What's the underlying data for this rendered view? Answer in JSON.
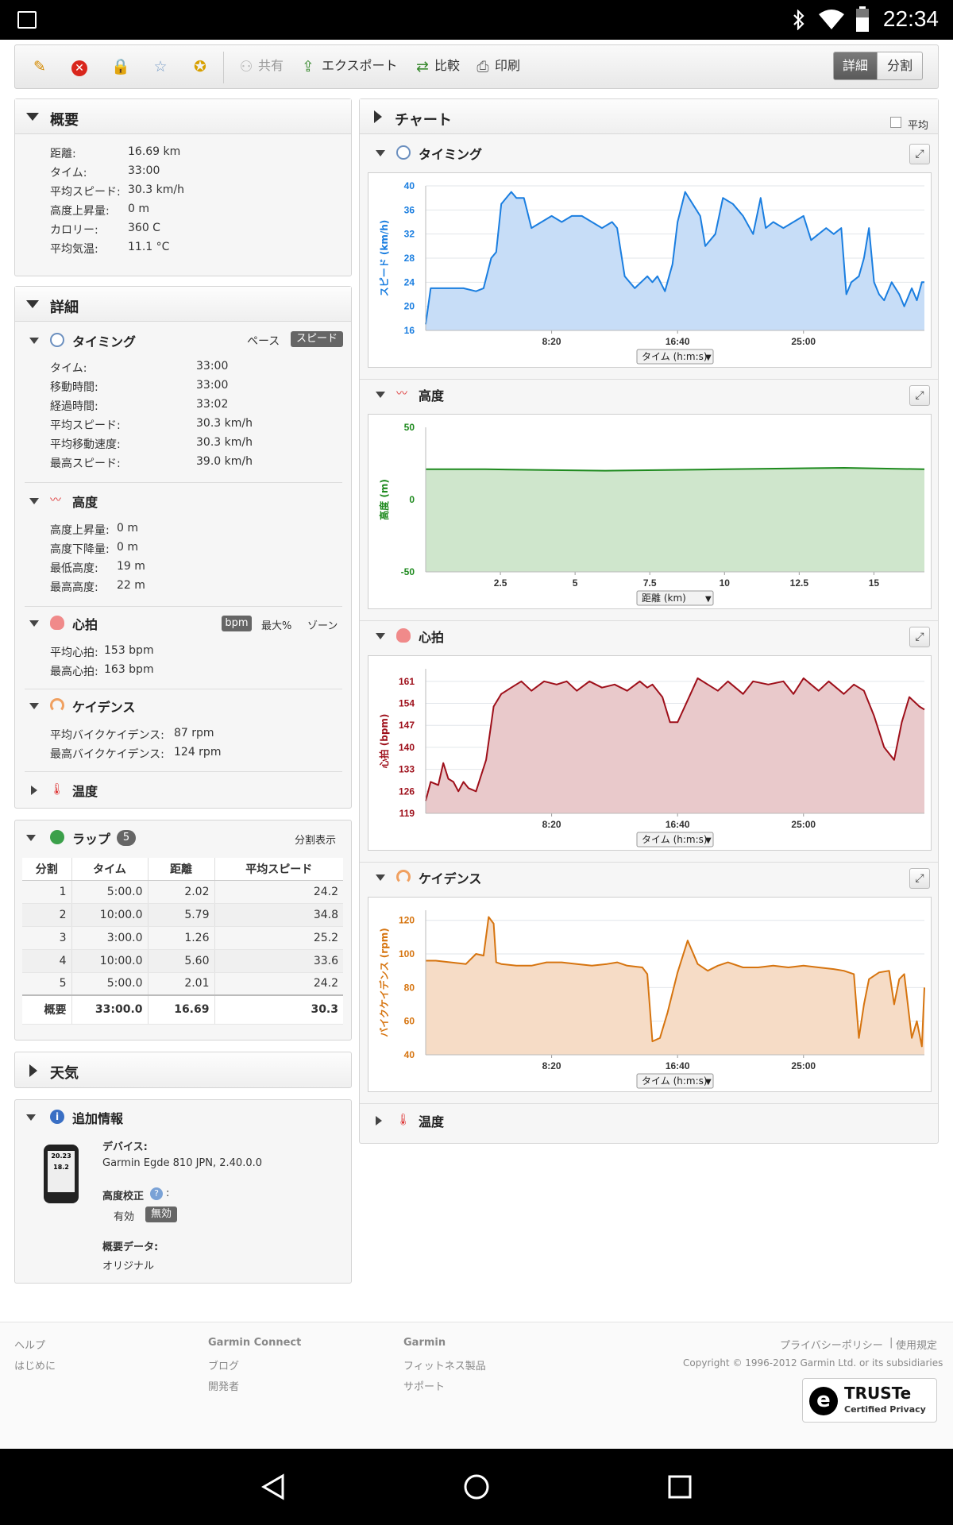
{
  "status_bar": {
    "time": "22:34"
  },
  "toolbar": {
    "share": "共有",
    "export": "エクスポート",
    "compare": "比較",
    "print": "印刷",
    "view_detail": "詳細",
    "view_split": "分割"
  },
  "summary": {
    "title": "概要",
    "rows": [
      {
        "label": "距離:",
        "value": "16.69 km"
      },
      {
        "label": "タイム:",
        "value": "33:00"
      },
      {
        "label": "平均スピード:",
        "value": "30.3 km/h"
      },
      {
        "label": "高度上昇量:",
        "value": "0 m"
      },
      {
        "label": "カロリー:",
        "value": "360 C"
      },
      {
        "label": "平均気温:",
        "value": "11.1 °C"
      }
    ]
  },
  "details": {
    "title": "詳細",
    "timing": {
      "title": "タイミング",
      "pace": "ペース",
      "speed": "スピード",
      "rows": [
        {
          "label": "タイム:",
          "value": "33:00"
        },
        {
          "label": "移動時間:",
          "value": "33:00"
        },
        {
          "label": "経過時間:",
          "value": "33:02"
        },
        {
          "label": "平均スピード:",
          "value": "30.3 km/h"
        },
        {
          "label": "平均移動速度:",
          "value": "30.3 km/h"
        },
        {
          "label": "最高スピード:",
          "value": "39.0 km/h"
        }
      ]
    },
    "elevation": {
      "title": "高度",
      "rows": [
        {
          "label": "高度上昇量:",
          "value": "0 m"
        },
        {
          "label": "高度下降量:",
          "value": "0 m"
        },
        {
          "label": "最低高度:",
          "value": "19 m"
        },
        {
          "label": "最高高度:",
          "value": "22 m"
        }
      ]
    },
    "heart": {
      "title": "心拍",
      "bpm": "bpm",
      "max_pct": "最大%",
      "zone": "ゾーン",
      "rows": [
        {
          "label": "平均心拍:",
          "value": "153 bpm"
        },
        {
          "label": "最高心拍:",
          "value": "163 bpm"
        }
      ]
    },
    "cadence": {
      "title": "ケイデンス",
      "rows": [
        {
          "label": "平均バイクケイデンス:",
          "value": "87 rpm"
        },
        {
          "label": "最高バイクケイデンス:",
          "value": "124 rpm"
        }
      ]
    },
    "temperature": {
      "title": "温度"
    }
  },
  "laps": {
    "title": "ラップ",
    "count": "5",
    "split_view": "分割表示",
    "headers": [
      "分割",
      "タイム",
      "距離",
      "平均スピード"
    ],
    "rows": [
      [
        "1",
        "5:00.0",
        "2.02",
        "24.2"
      ],
      [
        "2",
        "10:00.0",
        "5.79",
        "34.8"
      ],
      [
        "3",
        "3:00.0",
        "1.26",
        "25.2"
      ],
      [
        "4",
        "10:00.0",
        "5.60",
        "33.6"
      ],
      [
        "5",
        "5:00.0",
        "2.01",
        "24.2"
      ]
    ],
    "total": [
      "概要",
      "33:00.0",
      "16.69",
      "30.3"
    ]
  },
  "weather": {
    "title": "天気"
  },
  "additional": {
    "title": "追加情報",
    "device_label": "デバイス:",
    "device_value": "Garmin Egde 810 JPN, 2.40.0.0",
    "elev_corr_label": "高度校正",
    "elev_corr_colon": ":",
    "enabled": "有効",
    "disabled": "無効",
    "summary_label": "概要データ:",
    "summary_value": "オリジナル",
    "device_screen_1": "20.23",
    "device_screen_2": "18.2"
  },
  "charts_panel": {
    "title": "チャート",
    "average": "平均",
    "sections": {
      "timing": "タイミング",
      "elevation": "高度",
      "heart": "心拍",
      "cadence": "ケイデンス",
      "temperature": "温度"
    }
  },
  "chart_data": [
    {
      "id": "speed",
      "type": "area",
      "color": "#1a7ee0",
      "fill": "#c7ddf7",
      "ylabel": "スピード (km/h)",
      "ylim": [
        16,
        40
      ],
      "yticks": [
        16,
        20,
        24,
        28,
        32,
        36,
        40
      ],
      "xlim": [
        0,
        1980
      ],
      "xticks": [
        {
          "v": 500,
          "t": "8:20"
        },
        {
          "v": 1000,
          "t": "16:40"
        },
        {
          "v": 1500,
          "t": "25:00"
        }
      ],
      "selector": "タイム (h:m:s)",
      "grid": true,
      "x": [
        0,
        20,
        60,
        100,
        150,
        200,
        230,
        260,
        280,
        300,
        340,
        360,
        390,
        420,
        460,
        500,
        540,
        580,
        620,
        660,
        700,
        740,
        760,
        790,
        830,
        880,
        900,
        920,
        950,
        980,
        1000,
        1030,
        1060,
        1090,
        1110,
        1150,
        1180,
        1220,
        1260,
        1300,
        1330,
        1350,
        1380,
        1420,
        1460,
        1500,
        1530,
        1560,
        1590,
        1620,
        1650,
        1670,
        1690,
        1720,
        1740,
        1760,
        1780,
        1800,
        1820,
        1850,
        1880,
        1900,
        1930,
        1950,
        1970,
        1980
      ],
      "y": [
        17,
        23,
        23,
        23,
        23,
        22.5,
        23,
        28,
        29,
        37,
        39,
        38,
        38,
        33,
        34,
        35,
        34,
        35,
        35,
        34,
        33,
        34,
        33,
        25,
        23,
        25,
        24,
        25,
        22.5,
        27,
        34,
        39,
        37,
        35,
        30,
        32,
        38,
        37,
        35,
        32,
        38,
        33,
        34,
        33,
        34,
        35,
        31,
        32,
        33,
        32,
        33,
        22,
        24,
        25,
        28,
        33,
        24,
        22,
        21,
        24,
        22,
        20,
        23,
        21,
        24,
        24
      ]
    },
    {
      "id": "elevation",
      "type": "area",
      "color": "#1e8a1e",
      "fill": "#cfe6cc",
      "ylabel": "高度 (m)",
      "ylim": [
        -50,
        50
      ],
      "yticks": [
        -50,
        0,
        50
      ],
      "xlim": [
        0,
        16.69
      ],
      "xticks": [
        {
          "v": 2.5,
          "t": "2.5"
        },
        {
          "v": 5,
          "t": "5"
        },
        {
          "v": 7.5,
          "t": "7.5"
        },
        {
          "v": 10,
          "t": "10"
        },
        {
          "v": 12.5,
          "t": "12.5"
        },
        {
          "v": 15,
          "t": "15"
        }
      ],
      "selector": "距離 (km)",
      "grid": false,
      "x": [
        0,
        2,
        4,
        6,
        8,
        10,
        12,
        14,
        16.69
      ],
      "y": [
        21,
        21,
        20.5,
        20,
        20.5,
        21,
        21.5,
        22,
        21
      ]
    },
    {
      "id": "heart",
      "type": "area",
      "color": "#9e0f1a",
      "fill": "#e9c9cb",
      "ylabel": "心拍 (bpm)",
      "ylim": [
        119,
        165
      ],
      "yticks": [
        119,
        126,
        133,
        140,
        147,
        154,
        161
      ],
      "xlim": [
        0,
        1980
      ],
      "xticks": [
        {
          "v": 500,
          "t": "8:20"
        },
        {
          "v": 1000,
          "t": "16:40"
        },
        {
          "v": 1500,
          "t": "25:00"
        }
      ],
      "selector": "タイム (h:m:s)",
      "grid": true,
      "x": [
        0,
        20,
        50,
        70,
        90,
        110,
        130,
        150,
        170,
        200,
        240,
        270,
        300,
        340,
        380,
        420,
        470,
        520,
        560,
        600,
        650,
        700,
        750,
        800,
        850,
        880,
        900,
        940,
        970,
        1000,
        1040,
        1080,
        1120,
        1160,
        1200,
        1260,
        1300,
        1360,
        1420,
        1460,
        1500,
        1560,
        1600,
        1660,
        1700,
        1740,
        1780,
        1820,
        1860,
        1890,
        1920,
        1960,
        1980
      ],
      "y": [
        123,
        129,
        128,
        135,
        130,
        129,
        126,
        129,
        127,
        126,
        136,
        153,
        157,
        159,
        161,
        158,
        161,
        160,
        161,
        158,
        161,
        159,
        160,
        158,
        161,
        159,
        160,
        156,
        148,
        148,
        155,
        162,
        160,
        158,
        161,
        157,
        161,
        160,
        161,
        157,
        162,
        158,
        161,
        157,
        160,
        158,
        150,
        140,
        136,
        148,
        156,
        153,
        152
      ]
    },
    {
      "id": "cadence",
      "type": "area",
      "color": "#d6740f",
      "fill": "#f6dcc6",
      "ylabel": "バイクケイデンス (rpm)",
      "ylim": [
        40,
        126
      ],
      "yticks": [
        40,
        60,
        80,
        100,
        120
      ],
      "xlim": [
        0,
        1980
      ],
      "xticks": [
        {
          "v": 500,
          "t": "8:20"
        },
        {
          "v": 1000,
          "t": "16:40"
        },
        {
          "v": 1500,
          "t": "25:00"
        }
      ],
      "selector": "タイム (h:m:s)",
      "grid": true,
      "x": [
        0,
        40,
        100,
        160,
        200,
        230,
        250,
        270,
        280,
        300,
        360,
        420,
        480,
        540,
        600,
        660,
        720,
        760,
        800,
        860,
        880,
        900,
        930,
        960,
        1000,
        1040,
        1080,
        1120,
        1160,
        1200,
        1260,
        1320,
        1380,
        1440,
        1500,
        1560,
        1620,
        1660,
        1700,
        1720,
        1740,
        1760,
        1800,
        1840,
        1860,
        1880,
        1900,
        1930,
        1950,
        1970,
        1980
      ],
      "y": [
        96,
        96,
        95,
        94,
        100,
        99,
        122,
        118,
        95,
        94,
        93,
        93,
        95,
        95,
        94,
        93,
        94,
        95,
        93,
        92,
        88,
        48,
        50,
        65,
        89,
        108,
        94,
        90,
        93,
        95,
        92,
        92,
        93,
        92,
        93,
        92,
        91,
        90,
        88,
        50,
        70,
        85,
        89,
        90,
        70,
        85,
        88,
        50,
        60,
        45,
        80
      ]
    }
  ],
  "footer": {
    "help": "ヘルプ",
    "getting_started": "はじめに",
    "gc_title": "Garmin Connect",
    "blog": "ブログ",
    "developers": "開発者",
    "garmin_title": "Garmin",
    "fitness": "フィットネス製品",
    "support": "サポート",
    "privacy": "プライバシーポリシー",
    "sep": "|",
    "terms": "使用規定",
    "copyright": "Copyright © 1996-2012 Garmin Ltd. or its subsidiaries",
    "truste": "TRUSTe",
    "truste_sub": "Certified Privacy"
  }
}
